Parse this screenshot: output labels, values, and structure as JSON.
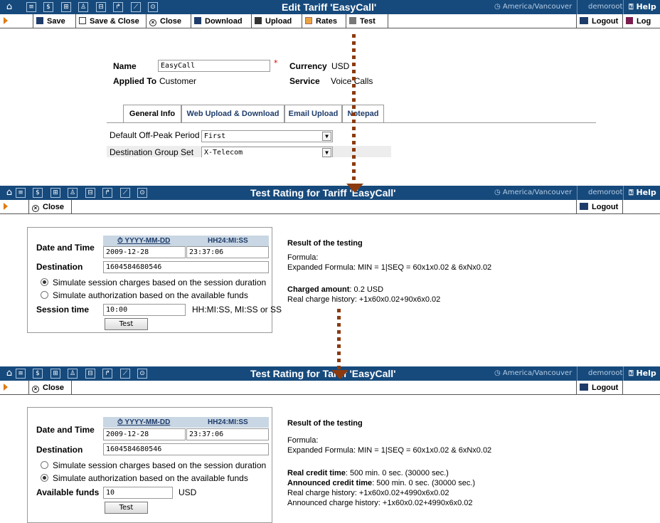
{
  "titlebar": {
    "icons": [
      "home-icon",
      "list-icon",
      "dollar-icon",
      "grid-icon",
      "person-icon",
      "tree-icon",
      "export-icon",
      "chart-icon",
      "search-icon"
    ],
    "timezone": "America/Vancouver",
    "user": "demoroot",
    "help": "Help",
    "tz_icon": "clock-icon"
  },
  "edit": {
    "title": "Edit Tariff 'EasyCall'",
    "toolbar": {
      "save": "Save",
      "save_close": "Save & Close",
      "close": "Close",
      "download": "Download",
      "upload": "Upload",
      "rates": "Rates",
      "test": "Test",
      "logout": "Logout",
      "log": "Log"
    },
    "form": {
      "name_label": "Name",
      "name_value": "EasyCall",
      "required_mark": "*",
      "currency_label": "Currency",
      "currency_value": "USD",
      "applied_label": "Applied To",
      "applied_value": "Customer",
      "service_label": "Service",
      "service_value": "Voice Calls"
    },
    "tabs": [
      "General Info",
      "Web Upload & Download",
      "Email Upload",
      "Notepad"
    ],
    "rows": {
      "offpeak_label": "Default Off-Peak Period",
      "offpeak_value": "First",
      "destgroup_label": "Destination Group Set",
      "destgroup_value": "X-Telecom"
    }
  },
  "test1": {
    "title": "Test Rating for Tariff 'EasyCall'",
    "close": "Close",
    "logout": "Logout",
    "date_label": "Date and Time",
    "date_format": "YYYY-MM-DD",
    "time_format": "HH24:MI:SS",
    "date_value": "2009-12-28",
    "time_value": "23:37:06",
    "dest_label": "Destination",
    "dest_value": "1604584680546",
    "radio1": "Simulate session charges based on the session duration",
    "radio2": "Simulate authorization based on the available funds",
    "selected_radio": 1,
    "session_label": "Session time",
    "session_value": "10:00",
    "session_hint": "HH:MI:SS, MI:SS or SS",
    "test_button": "Test",
    "result_title": "Result of the testing",
    "formula": "Formula:",
    "expanded": "Expanded Formula: MIN = 1|SEQ = 60x1x0.02 & 6xNx0.02",
    "charged_label": "Charged amount",
    "charged_value": ": 0.2 USD",
    "history": "Real charge history: +1x60x0.02+90x6x0.02"
  },
  "test2": {
    "title": "Test Rating for Tariff 'EasyCall'",
    "close": "Close",
    "logout": "Logout",
    "date_label": "Date and Time",
    "date_format": "YYYY-MM-DD",
    "time_format": "HH24:MI:SS",
    "date_value": "2009-12-28",
    "time_value": "23:37:06",
    "dest_label": "Destination",
    "dest_value": "1604584680546",
    "radio1": "Simulate session charges based on the session duration",
    "radio2": "Simulate authorization based on the available funds",
    "selected_radio": 2,
    "funds_label": "Available funds",
    "funds_value": "10",
    "funds_unit": "USD",
    "test_button": "Test",
    "result_title": "Result of the testing",
    "formula": "Formula:",
    "expanded": "Expanded Formula: MIN = 1|SEQ = 60x1x0.02 & 6xNx0.02",
    "real_credit_label": "Real credit time",
    "real_credit_value": ": 500 min. 0 sec. (30000 sec.)",
    "announced_label": "Announced credit time",
    "announced_value": ": 500 min. 0 sec. (30000 sec.)",
    "real_history": "Real charge history: +1x60x0.02+4990x6x0.02",
    "announced_history": "Announced charge history: +1x60x0.02+4990x6x0.02"
  },
  "colors": {
    "titlebar": "#174a7c",
    "arrow": "#8b3a0f",
    "accent_orange": "#e07a10"
  }
}
